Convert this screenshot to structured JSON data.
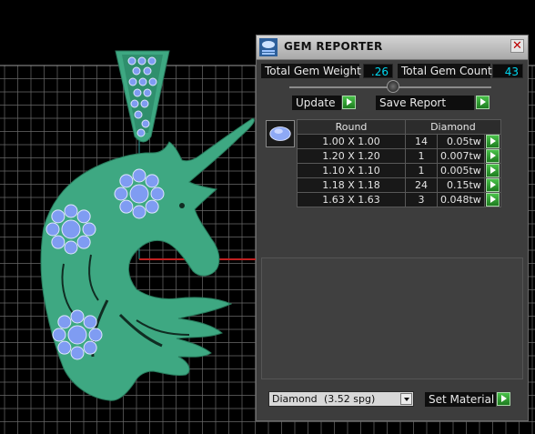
{
  "window": {
    "title": "GEM REPORTER",
    "close_glyph": "✕"
  },
  "totals": {
    "weight_label": "Total Gem Weight",
    "weight_value": ".26",
    "count_label": "Total Gem Count",
    "count_value": "43"
  },
  "buttons": {
    "update_label": "Update",
    "save_report_label": "Save Report",
    "set_material_label": "Set Material"
  },
  "table": {
    "headers": [
      "Round",
      "Diamond"
    ],
    "rows": [
      {
        "size": "1.00 X 1.00",
        "count": "14",
        "weight": "0.05tw"
      },
      {
        "size": "1.20 X 1.20",
        "count": "1",
        "weight": "0.007tw"
      },
      {
        "size": "1.10 X 1.10",
        "count": "1",
        "weight": "0.005tw"
      },
      {
        "size": "1.18 X 1.18",
        "count": "24",
        "weight": "0.15tw"
      },
      {
        "size": "1.63 X 1.63",
        "count": "3",
        "weight": "0.048tw"
      }
    ]
  },
  "material": {
    "selected": "Diamond",
    "spg": "(3.52 spg)"
  },
  "colors": {
    "pendant": "#3ea882",
    "gem": "#7f9cf2",
    "grid": "#6a6a6a",
    "accent_value": "#00d8f0",
    "button_green": "#2ea32f"
  },
  "icons": [
    "app-icon",
    "close-icon",
    "gem-icon",
    "play-icon",
    "dropdown-arrow-icon"
  ]
}
